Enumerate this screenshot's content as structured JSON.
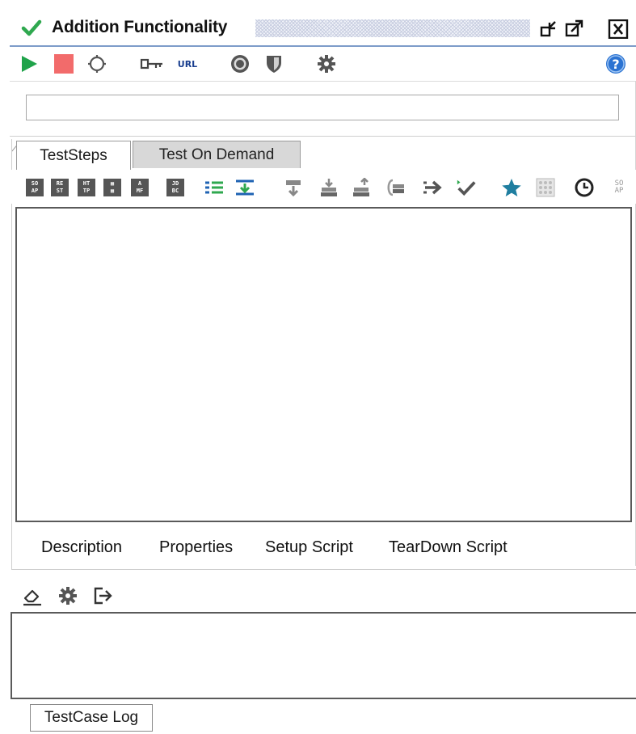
{
  "window": {
    "title": "Addition Functionality",
    "title_check_icon": "checkmark-icon",
    "buttons": [
      "restore-icon",
      "undock-icon",
      "close-icon"
    ]
  },
  "toolbar": {
    "icons": [
      "run-icon",
      "stop-icon",
      "loop-icon",
      "key-icon",
      "url-icon",
      "gauge-icon",
      "shield-icon",
      "gear-icon",
      "help-icon"
    ],
    "url_label": "URL",
    "help_label": "?"
  },
  "search": {
    "value": "",
    "placeholder": ""
  },
  "tabs": [
    {
      "label": "TestSteps",
      "active": true
    },
    {
      "label": "Test On Demand",
      "active": false
    }
  ],
  "step_toolbar": {
    "blocks": [
      {
        "name": "soap-step-icon",
        "l1": "SO",
        "l2": "AP"
      },
      {
        "name": "rest-step-icon",
        "l1": "RE",
        "l2": "ST"
      },
      {
        "name": "http-step-icon",
        "l1": "HT",
        "l2": "TP"
      },
      {
        "name": "amf-step-icon",
        "l1": "A",
        "l2": "MF"
      },
      {
        "name": "jdbc-step-icon",
        "l1": "JD",
        "l2": "BC"
      }
    ],
    "last_block": {
      "name": "soap-mock-icon",
      "l1": "SO",
      "l2": "AP"
    }
  },
  "bottom_tabs": [
    "Description",
    "Properties",
    "Setup Script",
    "TearDown Script"
  ],
  "log_toolbar": [
    "eraser-icon",
    "gear-icon",
    "export-icon"
  ],
  "log_tab": "TestCase Log",
  "colors": {
    "accent_border": "#7d9cc9",
    "run_green": "#1fa34a",
    "stop_red": "#f26b6b",
    "list_blue": "#1f63b3",
    "list_green": "#2fa84f",
    "star_teal": "#1f7ea0",
    "help_blue": "#2b73d2"
  }
}
